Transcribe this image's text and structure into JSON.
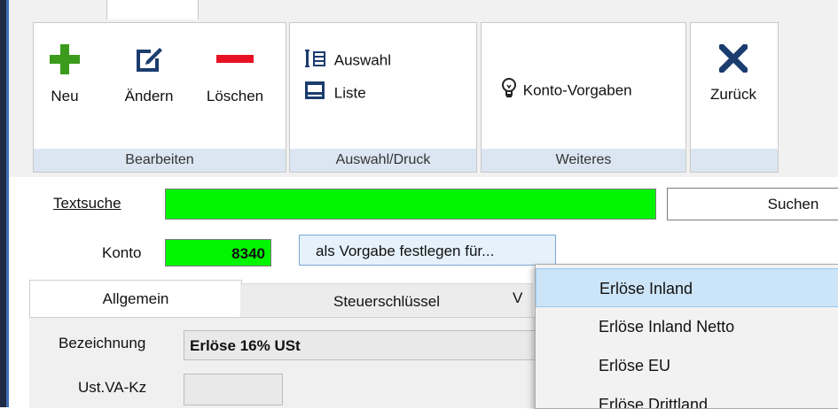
{
  "ribbon": {
    "groups": [
      {
        "label": "Bearbeiten",
        "buttons": [
          {
            "label": "Neu",
            "icon": "plus-icon"
          },
          {
            "label": "Ändern",
            "icon": "edit-icon"
          },
          {
            "label": "Löschen",
            "icon": "minus-icon"
          }
        ]
      },
      {
        "label": "Auswahl/Druck",
        "buttons": [
          {
            "label": "Auswahl",
            "icon": "list-select-icon"
          },
          {
            "label": "Liste",
            "icon": "printer-icon"
          }
        ]
      },
      {
        "label": "Weiteres",
        "buttons": [
          {
            "label": "Konto-Vorgaben",
            "icon": "lightbulb-icon"
          }
        ]
      },
      {
        "label": "",
        "buttons": [
          {
            "label": "Zurück",
            "icon": "close-icon"
          }
        ]
      }
    ]
  },
  "search": {
    "label": "Textsuche",
    "value": "",
    "button": "Suchen"
  },
  "konto": {
    "label": "Konto",
    "value": "8340",
    "vorgabe_button": "als Vorgabe festlegen für..."
  },
  "tabs": [
    {
      "label": "Allgemein",
      "active": true
    },
    {
      "label": "Steuerschlüssel",
      "active": false
    },
    {
      "label": "V",
      "active": false
    }
  ],
  "form": {
    "bezeichnung_label": "Bezeichnung",
    "bezeichnung_value": "Erlöse 16% USt",
    "ustvakz_label": "Ust.VA-Kz",
    "ustvakz_value": ""
  },
  "dropdown": {
    "items": [
      "Erlöse Inland",
      "Erlöse Inland Netto",
      "Erlöse EU",
      "Erlöse Drittland"
    ],
    "selected": "Erlöse Inland"
  },
  "colors": {
    "search_field": "#00f500",
    "konto_field": "#00f500",
    "delete_icon": "#e81123",
    "add_icon": "#3a9b1c",
    "edit_icon": "#1b3c6e"
  }
}
